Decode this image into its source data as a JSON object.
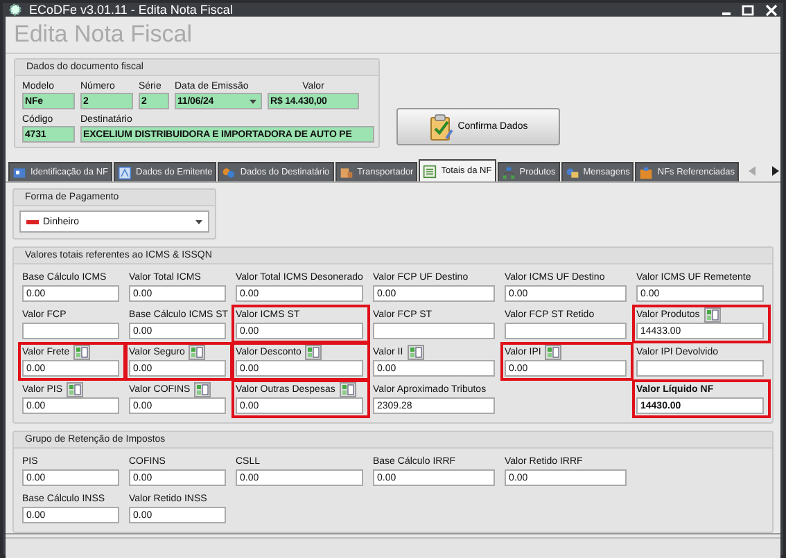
{
  "window": {
    "title": "ECoDFe v3.01.11 - Edita Nota Fiscal"
  },
  "heading": "Edita Nota Fiscal",
  "document": {
    "title": "Dados do documento fiscal",
    "row_1": [
      {
        "label": "Modelo",
        "value": "NFe",
        "kind": "text"
      },
      {
        "label": "Número",
        "value": "2",
        "kind": "text"
      },
      {
        "label": "Série",
        "value": "2",
        "kind": "text"
      },
      {
        "label": "Data de Emissão",
        "value": "11/06/24",
        "kind": "date"
      },
      {
        "label": "Valor",
        "value": "R$ 14.430,00",
        "kind": "text"
      }
    ],
    "row_2": [
      {
        "label": "Código",
        "value": "4731",
        "kind": "text"
      },
      {
        "label": "Destinatário",
        "value": "EXCELIUM DISTRIBUIDORA E IMPORTADORA DE AUTO PE",
        "kind": "text"
      }
    ]
  },
  "confirm_button": "Confirma Dados",
  "tabs": [
    {
      "label": "Identificação da NF",
      "selected": false
    },
    {
      "label": "Dados do Emitente",
      "selected": false
    },
    {
      "label": "Dados do Destinatário",
      "selected": false
    },
    {
      "label": "Transportador",
      "selected": false
    },
    {
      "label": "Totais da NF",
      "selected": true
    },
    {
      "label": "Produtos",
      "selected": false
    },
    {
      "label": "Mensagens",
      "selected": false
    },
    {
      "label": "NFs Referenciadas",
      "selected": false
    }
  ],
  "payment": {
    "title": "Forma de Pagamento",
    "value": "Dinheiro"
  },
  "icms": {
    "title": "Valores totais referentes ao ICMS & ISSQN",
    "fields": [
      {
        "label": "Base Cálculo ICMS",
        "value": "0.00",
        "highlighted": false,
        "kind": "normal"
      },
      {
        "label": "Valor Total ICMS",
        "value": "0.00",
        "highlighted": false,
        "kind": "normal"
      },
      {
        "label": "Valor Total ICMS Desonerado",
        "value": "0.00",
        "highlighted": false,
        "kind": "normal"
      },
      {
        "label": "Valor FCP UF Destino",
        "value": "0.00",
        "highlighted": false,
        "kind": "normal"
      },
      {
        "label": "Valor ICMS UF Destino",
        "value": "0.00",
        "highlighted": false,
        "kind": "normal"
      },
      {
        "label": "Valor ICMS UF Remetente",
        "value": "0.00",
        "highlighted": false,
        "kind": "normal"
      },
      {
        "label": "Valor FCP",
        "highlighted": false,
        "kind": "normal"
      },
      {
        "label": "Base Cálculo ICMS ST",
        "value": "0.00",
        "highlighted": false,
        "kind": "normal"
      },
      {
        "label": "Valor ICMS ST",
        "value": "0.00",
        "highlighted": true,
        "kind": "normal"
      },
      {
        "label": "Valor FCP ST",
        "highlighted": false,
        "kind": "normal"
      },
      {
        "label": "Valor FCP ST Retido",
        "highlighted": false,
        "kind": "normal"
      },
      {
        "label": "Valor Produtos",
        "value": "14433.00",
        "highlighted": true,
        "calc": true,
        "kind": "normal"
      },
      {
        "label": "Valor Frete",
        "value": "0.00",
        "highlighted": true,
        "calc": true,
        "kind": "normal"
      },
      {
        "label": "Valor Seguro",
        "value": "0.00",
        "highlighted": true,
        "calc": true,
        "kind": "normal"
      },
      {
        "label": "Valor Desconto",
        "value": "0.00",
        "highlighted": true,
        "calc": true,
        "kind": "normal"
      },
      {
        "label": "Valor II",
        "value": "0.00",
        "highlighted": false,
        "calc": true,
        "kind": "normal"
      },
      {
        "label": "Valor IPI",
        "value": "0.00",
        "highlighted": true,
        "calc": true,
        "kind": "normal"
      },
      {
        "label": "Valor IPI Devolvido",
        "highlighted": false,
        "kind": "normal"
      },
      {
        "label": "Valor PIS",
        "value": "0.00",
        "highlighted": false,
        "calc": true,
        "kind": "normal"
      },
      {
        "label": "Valor COFINS",
        "value": "0.00",
        "highlighted": false,
        "calc": true,
        "kind": "normal"
      },
      {
        "label": "Valor Outras Despesas",
        "value": "0.00",
        "highlighted": true,
        "calc": true,
        "kind": "normal"
      },
      {
        "label": "Valor Aproximado Tributos",
        "value": "2309.28",
        "highlighted": false,
        "kind": "normal"
      },
      {
        "label": "Valor Líquido NF",
        "value": "14430.00",
        "highlighted": true,
        "kind": "total"
      }
    ]
  },
  "retention": {
    "title": "Grupo de Retenção de Impostos",
    "fields": [
      {
        "label": "PIS",
        "value": "0.00",
        "kind": "normal"
      },
      {
        "label": "COFINS",
        "value": "0.00",
        "kind": "normal"
      },
      {
        "label": "CSLL",
        "value": "0.00",
        "kind": "normal"
      },
      {
        "label": "Base Cálculo IRRF",
        "value": "0.00",
        "kind": "normal"
      },
      {
        "label": "Valor Retido IRRF",
        "value": "0.00",
        "kind": "normal"
      },
      {
        "label": "Base Cálculo INSS",
        "value": "0.00",
        "kind": "newline"
      },
      {
        "label": "Valor Retido INSS",
        "value": "0.00",
        "kind": "normal"
      }
    ]
  }
}
